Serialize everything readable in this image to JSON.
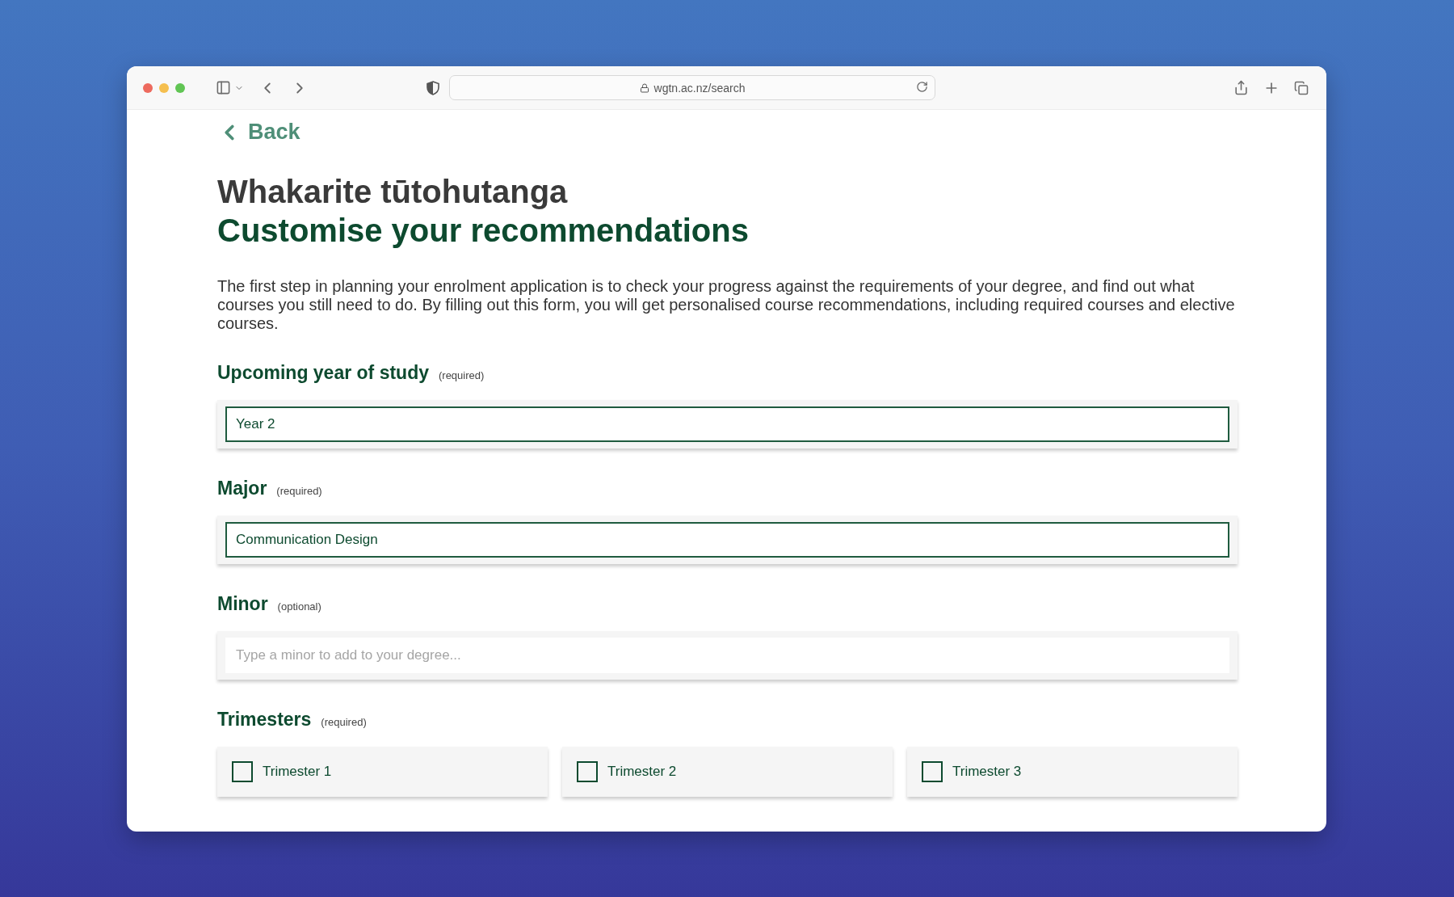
{
  "browser": {
    "url": "wgtn.ac.nz/search"
  },
  "back": {
    "label": "Back"
  },
  "title": "Whakarite tūtohutanga",
  "subtitle": "Customise your recommendations",
  "intro": "The first step in planning your enrolment application is to check your progress against the requirements of your degree, and find out what courses you still need to do. By filling out this form, you will get personalised course recommendations, including required courses and elective courses.",
  "fields": [
    {
      "label": "Upcoming year of study",
      "note": "(required)",
      "value": "Year 2"
    },
    {
      "label": "Major",
      "note": "(required)",
      "value": "Communication Design"
    },
    {
      "label": "Minor",
      "note": "(optional)",
      "placeholder": "Type a minor to add to your degree..."
    }
  ],
  "trimesters": {
    "label": "Trimesters",
    "note": "(required)",
    "options": [
      {
        "label": "Trimester 1",
        "checked": false
      },
      {
        "label": "Trimester 2",
        "checked": false
      },
      {
        "label": "Trimester 3",
        "checked": false
      }
    ]
  }
}
